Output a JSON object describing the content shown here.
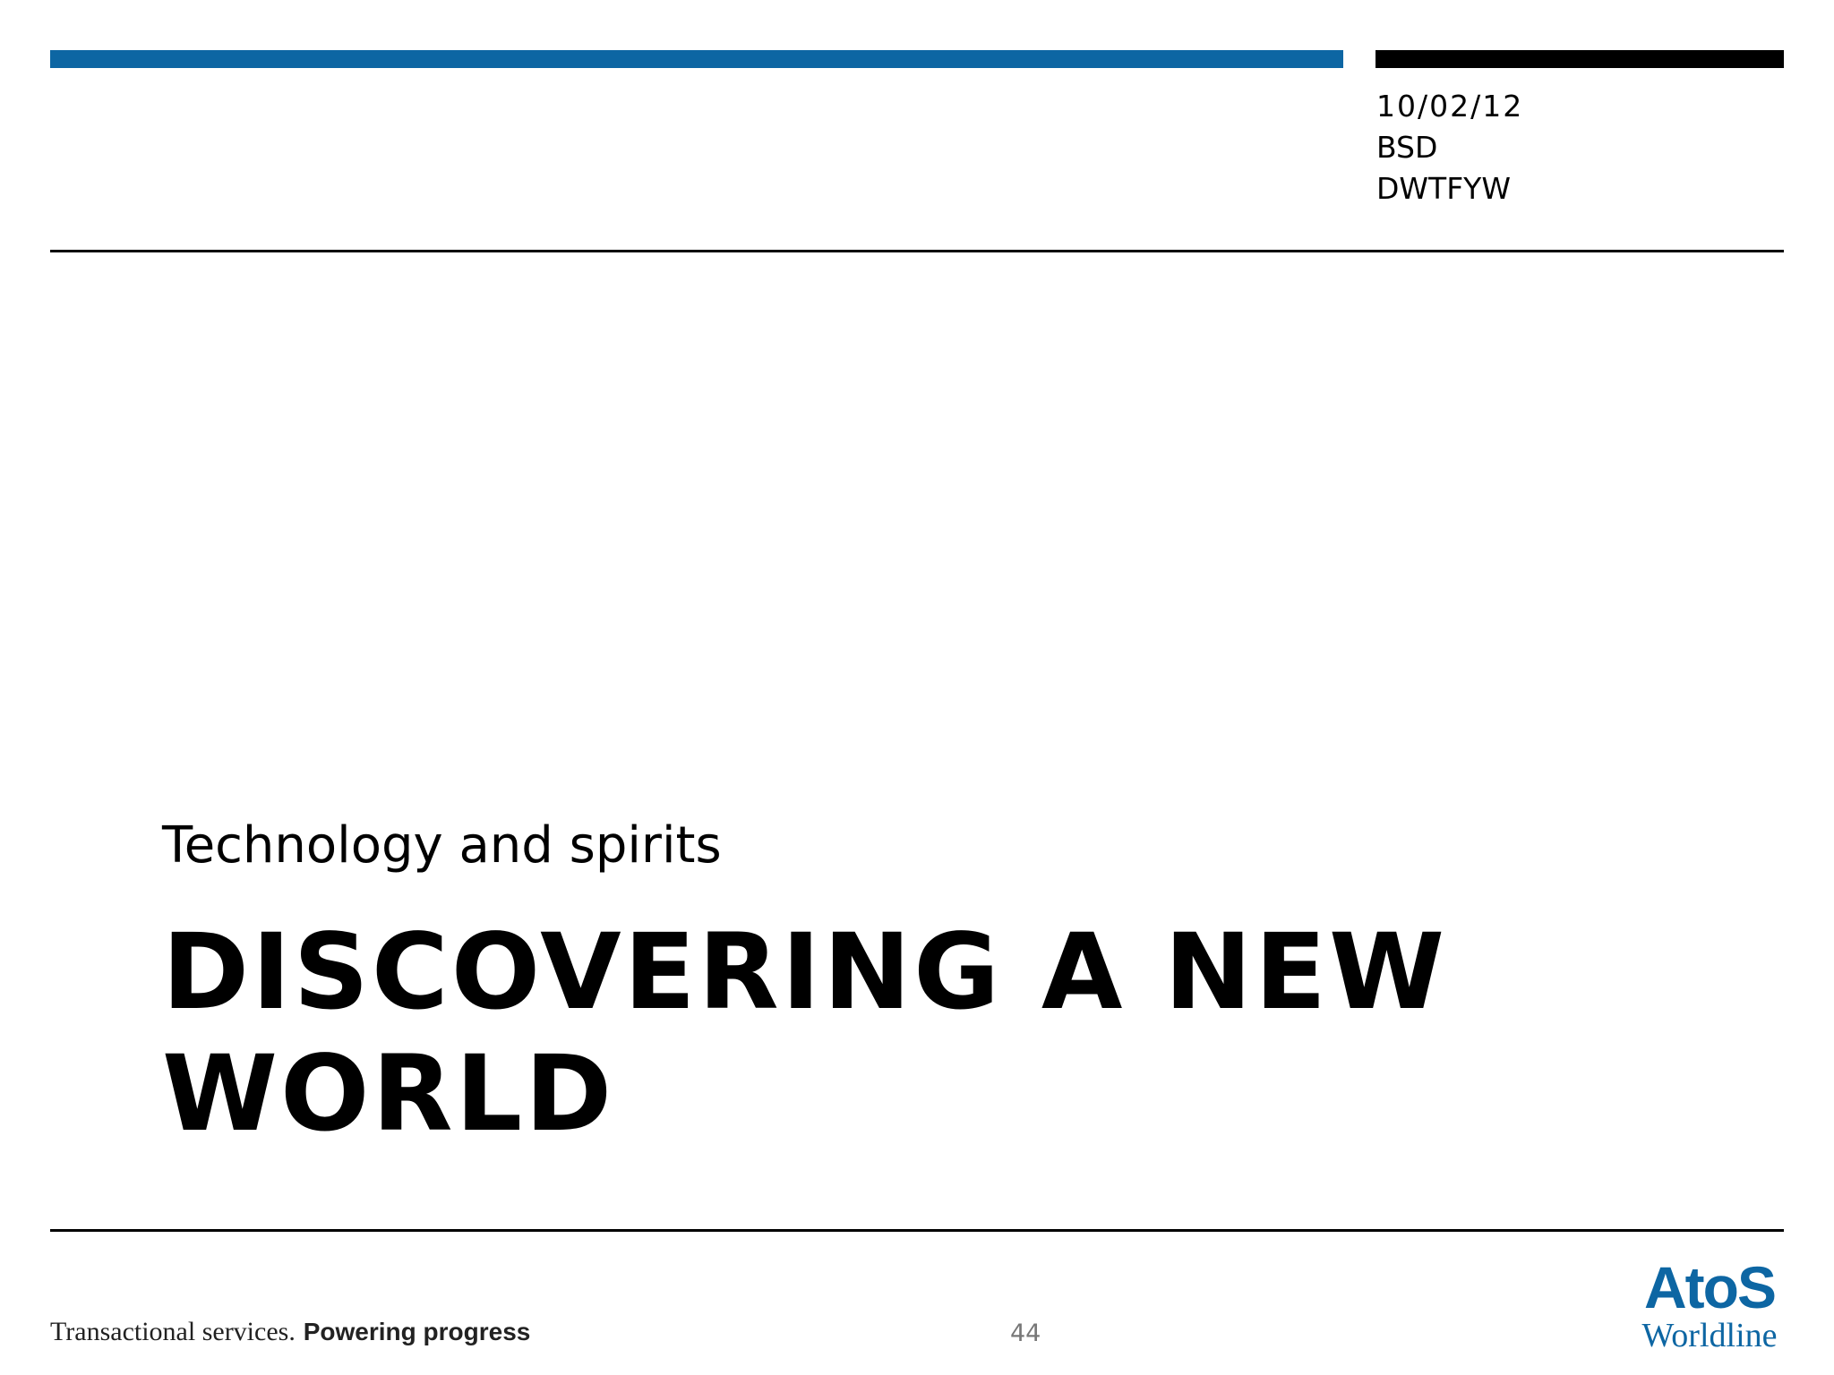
{
  "header": {
    "date": "10/02/12",
    "line2": "BSD",
    "line3": "DWTFYW"
  },
  "slide": {
    "subtitle": "Technology and spirits",
    "title": "DISCOVERING A NEW WORLD"
  },
  "footer": {
    "tagline_light": "Transactional services.",
    "tagline_strong": "Powering progress",
    "page_number": "44"
  },
  "logo": {
    "line1": "AtoS",
    "line2": "Worldline",
    "color": "#0d66a3"
  },
  "colors": {
    "accent_bar": "#0d66a3",
    "rule": "#000000"
  }
}
